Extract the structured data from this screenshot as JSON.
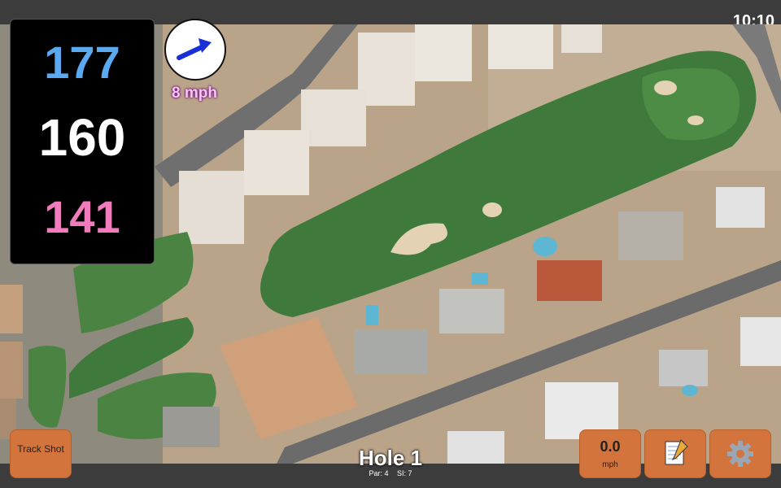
{
  "status": {
    "time": "10:10"
  },
  "distances": {
    "back": "177",
    "middle": "160",
    "front": "141",
    "colors": {
      "back": "#5ba9f0",
      "middle": "#ffffff",
      "front": "#f07bbd"
    }
  },
  "wind": {
    "speed_label": "8 mph",
    "arrow_icon": "wind-arrow-icon"
  },
  "buttons": {
    "track_shot": "Track Shot",
    "speed_value": "0.0",
    "speed_unit": "mph",
    "notes_icon": "notepad-icon",
    "settings_icon": "gear-icon"
  },
  "hole": {
    "title": "Hole 1",
    "par": "Par: 4",
    "si": "SI: 7"
  },
  "colors": {
    "accent_button": "#d2743c",
    "fairway": "#3f7a3c",
    "green": "#4c8c45",
    "bunker": "#e3d3b4"
  }
}
